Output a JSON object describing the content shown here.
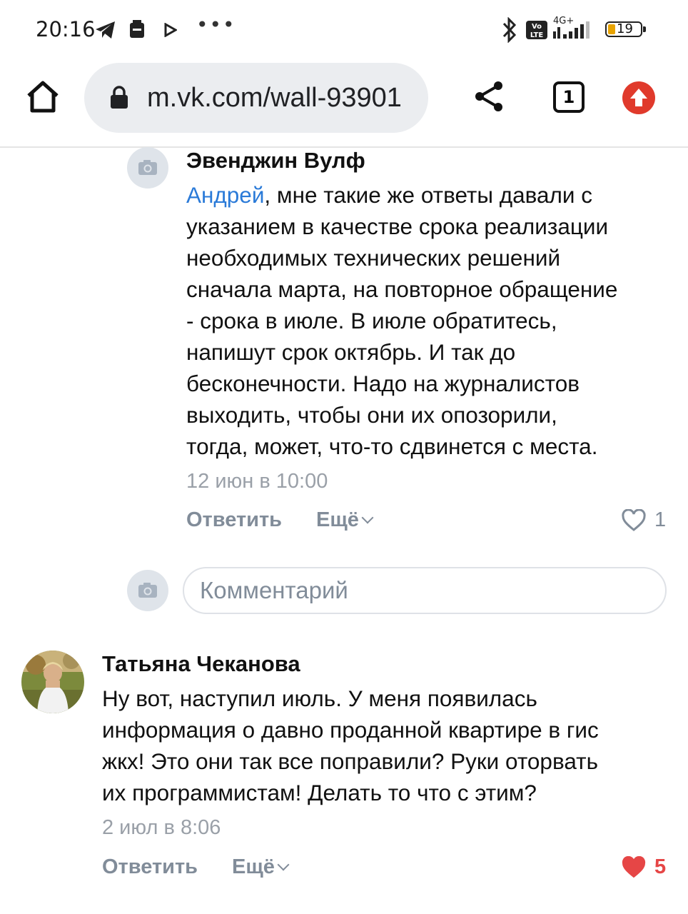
{
  "status_bar": {
    "time": "20:16",
    "network": "4G+",
    "volte": "Vo LTE",
    "battery_level": "19",
    "more_indicator": "•••"
  },
  "browser": {
    "url": "m.vk.com/wall-93901",
    "tab_count": "1",
    "icons": [
      "home-icon",
      "lock-icon",
      "share-icon",
      "tabs-icon",
      "update-icon"
    ]
  },
  "comments": [
    {
      "author": "Эвенджин Вулф",
      "mention": "Андрей",
      "text_lines": [
        ", мне такие же ответы давали с",
        "указанием в качестве срока реализации",
        "необходимых технических решений",
        "сначала марта, на повторное обращение",
        "- срока в июле. В июле обратитесь,",
        "напишут срок октябрь. И так до",
        "бесконечности. Надо на журналистов",
        "выходить, чтобы они их опозорили,",
        "тогда, может, что-то сдвинется с места."
      ],
      "date": "12 июн в 10:00",
      "reply_label": "Ответить",
      "more_label": "Ещё",
      "likes": "1",
      "liked": false
    },
    {
      "author": "Татьяна Чеканова",
      "text_lines": [
        "Ну вот, наступил июль. У меня появилась",
        "информация о давно проданной квартире в гис",
        "жкх! Это они так все поправили? Руки оторвать",
        "их программистам! Делать то что с этим?"
      ],
      "date": "2 июл в 8:06",
      "reply_label": "Ответить",
      "more_label": "Ещё",
      "likes": "5",
      "liked": true
    }
  ],
  "reply_box": {
    "placeholder": "Комментарий"
  },
  "colors": {
    "link": "#2a7ad8",
    "muted": "#818c99",
    "like_active": "#e64646",
    "update_badge": "#e03a2c"
  }
}
